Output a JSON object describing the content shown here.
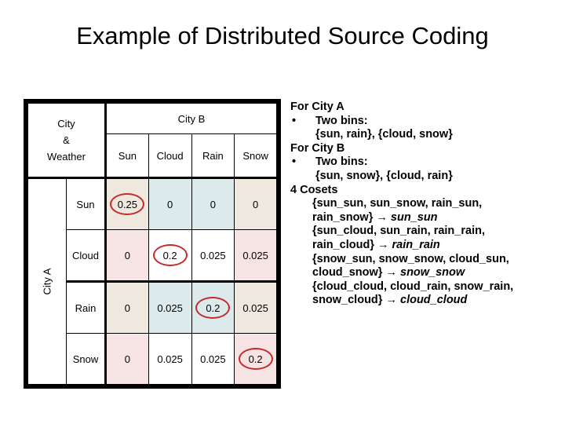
{
  "title": "Example of Distributed Source Coding",
  "table": {
    "corner_label": "City\n&\nWeather",
    "corner_line1": "City",
    "corner_line2": "&",
    "corner_line3": "Weather",
    "col_group_header": "City B",
    "row_group_header": "City A",
    "columns": [
      "Sun",
      "Cloud",
      "Rain",
      "Snow"
    ],
    "rows": [
      {
        "label": "Sun",
        "cells": [
          {
            "value": "0.25",
            "bg": "beige",
            "highlight": true
          },
          {
            "value": "0",
            "bg": "blue",
            "highlight": false
          },
          {
            "value": "0",
            "bg": "blue",
            "highlight": false
          },
          {
            "value": "0",
            "bg": "beige",
            "highlight": false
          }
        ]
      },
      {
        "label": "Cloud",
        "cells": [
          {
            "value": "0",
            "bg": "pink",
            "highlight": false
          },
          {
            "value": "0.2",
            "bg": "white",
            "highlight": true
          },
          {
            "value": "0.025",
            "bg": "white",
            "highlight": false
          },
          {
            "value": "0.025",
            "bg": "pink",
            "highlight": false
          }
        ]
      },
      {
        "label": "Rain",
        "cells": [
          {
            "value": "0",
            "bg": "beige",
            "highlight": false
          },
          {
            "value": "0.025",
            "bg": "blue",
            "highlight": false
          },
          {
            "value": "0.2",
            "bg": "blue",
            "highlight": true
          },
          {
            "value": "0.025",
            "bg": "beige",
            "highlight": false
          }
        ]
      },
      {
        "label": "Snow",
        "cells": [
          {
            "value": "0",
            "bg": "pink",
            "highlight": false
          },
          {
            "value": "0.025",
            "bg": "white",
            "highlight": false
          },
          {
            "value": "0.025",
            "bg": "white",
            "highlight": false
          },
          {
            "value": "0.2",
            "bg": "pink",
            "highlight": true
          }
        ]
      }
    ]
  },
  "notes": {
    "city_a_header": "For City A",
    "city_a_bullet": "Two bins:",
    "city_a_bins": "{sun, rain}, {cloud, snow}",
    "city_b_header": "For City B",
    "city_b_bullet": "Two bins:",
    "city_b_bins": "{sun, snow}, {cloud, rain}",
    "cosets_header": "4 Cosets",
    "bullet_glyph": "•",
    "arrow_glyph": "→",
    "cosets": [
      {
        "set": "{sun_sun, sun_snow, rain_sun, rain_snow}",
        "result": "sun_sun"
      },
      {
        "set": "{sun_cloud, sun_rain, rain_rain, rain_cloud}",
        "result": "rain_rain"
      },
      {
        "set": "{snow_sun, snow_snow, cloud_sun, cloud_snow}",
        "result": "snow_snow"
      },
      {
        "set": "{cloud_cloud, cloud_rain, snow_rain, snow_cloud}",
        "result": "cloud_cloud"
      }
    ]
  },
  "colors": {
    "beige": "#eee8de",
    "blue": "#dceaec",
    "pink": "#f6e3e3",
    "white": "#ffffff",
    "highlight_ring": "#c32a2a",
    "border": "#000000",
    "text": "#000000",
    "background": "#ffffff"
  }
}
